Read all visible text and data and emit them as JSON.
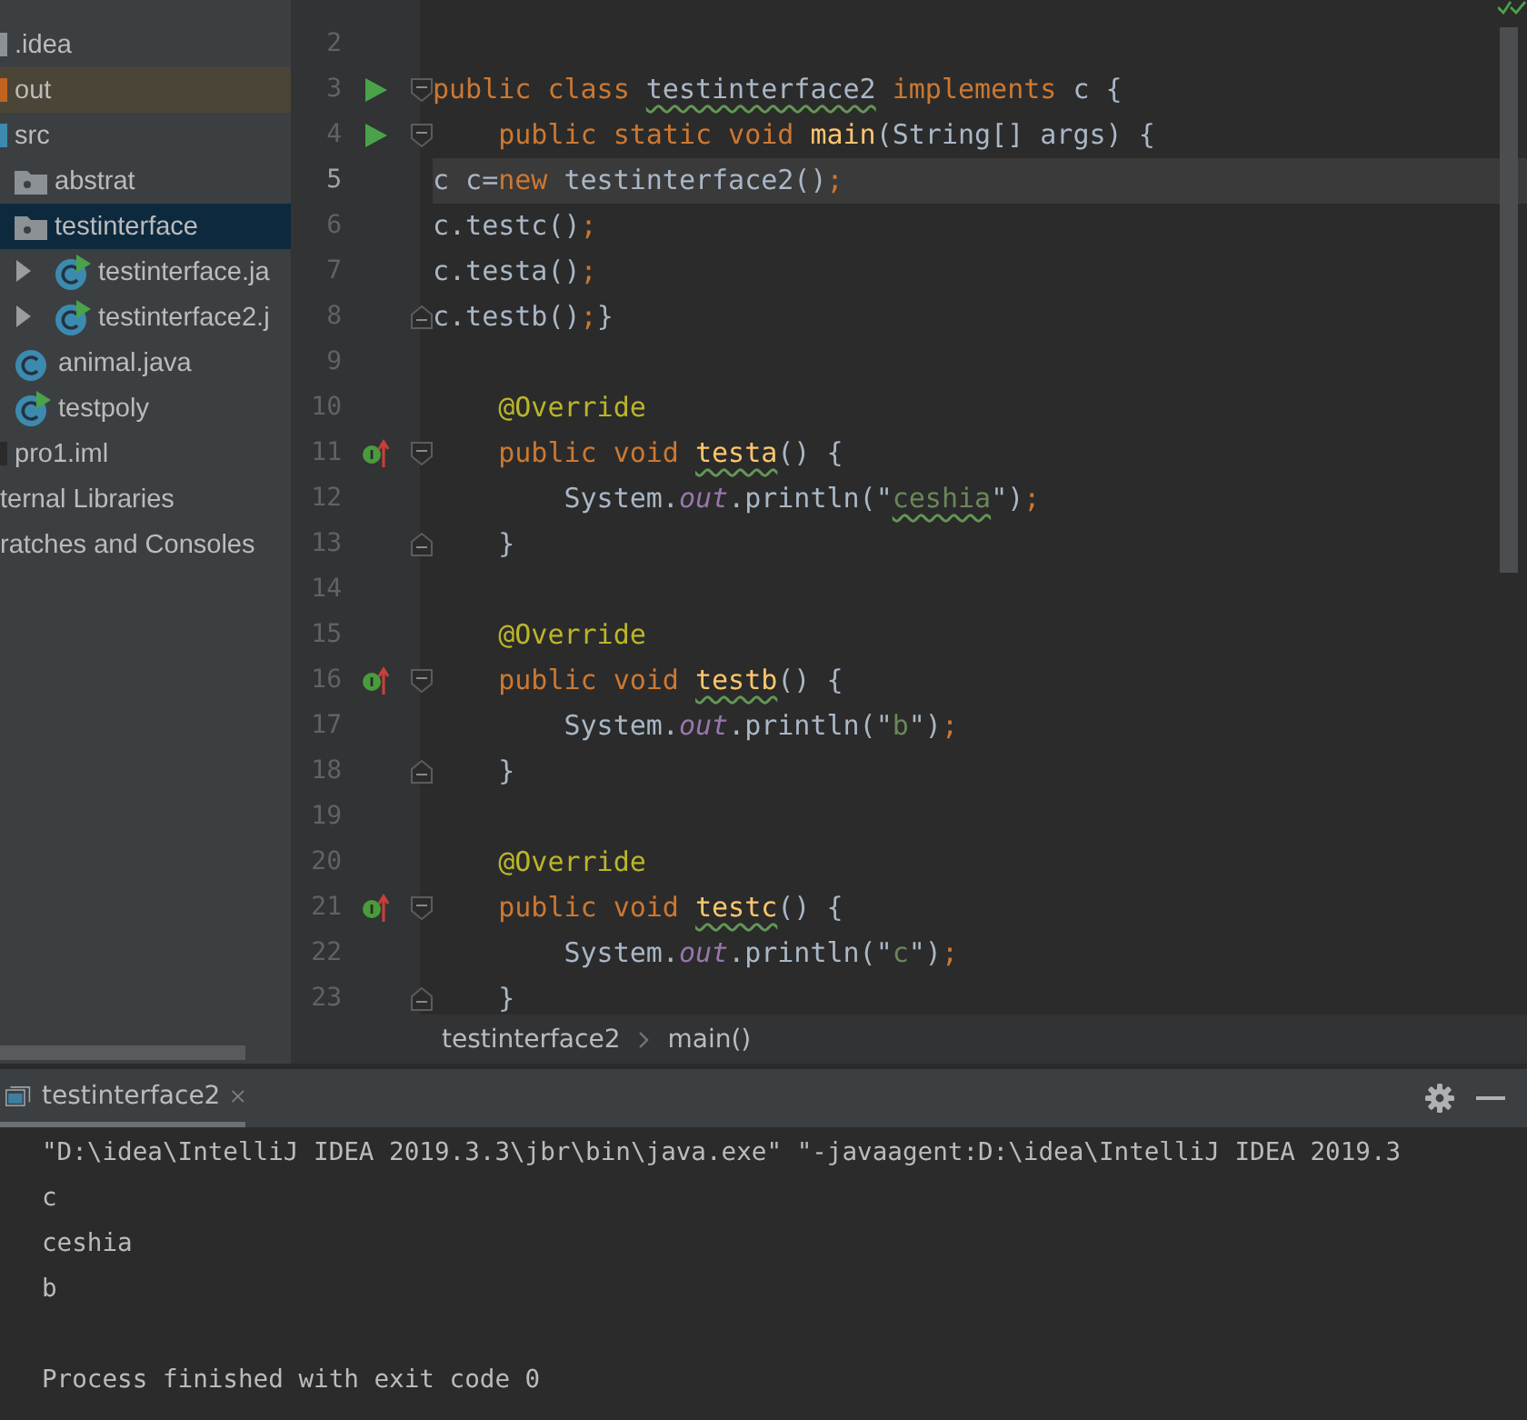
{
  "project_tree": {
    "items": [
      {
        "label": ".idea",
        "kind": "folder",
        "selected": false,
        "excluded": false
      },
      {
        "label": "out",
        "kind": "excluded-folder",
        "selected": false,
        "excluded": true
      },
      {
        "label": "src",
        "kind": "source-folder",
        "selected": false,
        "excluded": false,
        "children": [
          {
            "label": "abstrat",
            "kind": "package",
            "selected": false,
            "excluded": false
          },
          {
            "label": "testinterface",
            "kind": "package",
            "selected": true,
            "excluded": false,
            "children": [
              {
                "label": "testinterface.ja",
                "kind": "runnable-class",
                "selected": false,
                "excluded": false,
                "expanded": false
              },
              {
                "label": "testinterface2.j",
                "kind": "runnable-class",
                "selected": false,
                "excluded": false,
                "expanded": false
              }
            ]
          },
          {
            "label": "animal.java",
            "kind": "class",
            "selected": false,
            "excluded": false
          },
          {
            "label": "testpoly",
            "kind": "runnable-class",
            "selected": false,
            "excluded": false
          }
        ]
      },
      {
        "label": "pro1.iml",
        "kind": "file",
        "selected": false,
        "excluded": false
      },
      {
        "label": "ternal Libraries",
        "kind": "library",
        "selected": false,
        "excluded": false
      },
      {
        "label": "ratches and Consoles",
        "kind": "library",
        "selected": false,
        "excluded": false
      }
    ]
  },
  "editor": {
    "lines": [
      {
        "number": "2",
        "current": false,
        "run": false,
        "implements": false,
        "fold_start": false,
        "fold_end": false
      },
      {
        "number": "3",
        "current": false,
        "run": true,
        "implements": false,
        "fold_start": true,
        "fold_end": false,
        "tokens": [
          {
            "text": "public class ",
            "kind": "keyword"
          },
          {
            "text": "testinterface2",
            "kind": "plain",
            "underlined": true
          },
          {
            "text": " implements ",
            "kind": "keyword"
          },
          {
            "text": "c {",
            "kind": "plain"
          }
        ]
      },
      {
        "number": "4",
        "current": false,
        "run": true,
        "implements": false,
        "fold_start": true,
        "fold_end": false,
        "tokens": [
          {
            "text": "    public static void ",
            "kind": "keyword"
          },
          {
            "text": "main",
            "kind": "method"
          },
          {
            "text": "(String[] args) {",
            "kind": "plain"
          }
        ]
      },
      {
        "number": "5",
        "current": true,
        "run": false,
        "implements": false,
        "fold_start": false,
        "fold_end": false,
        "tokens": [
          {
            "text": "c c=",
            "kind": "plain"
          },
          {
            "text": "new",
            "kind": "keyword"
          },
          {
            "text": " testinterface2()",
            "kind": "plain"
          },
          {
            "text": ";",
            "kind": "keyword"
          }
        ]
      },
      {
        "number": "6",
        "current": false,
        "run": false,
        "implements": false,
        "fold_start": false,
        "fold_end": false,
        "tokens": [
          {
            "text": "c.testc()",
            "kind": "plain"
          },
          {
            "text": ";",
            "kind": "keyword"
          }
        ]
      },
      {
        "number": "7",
        "current": false,
        "run": false,
        "implements": false,
        "fold_start": false,
        "fold_end": false,
        "tokens": [
          {
            "text": "c.testa()",
            "kind": "plain"
          },
          {
            "text": ";",
            "kind": "keyword"
          }
        ]
      },
      {
        "number": "8",
        "current": false,
        "run": false,
        "implements": false,
        "fold_start": false,
        "fold_end": true,
        "tokens": [
          {
            "text": "c.testb()",
            "kind": "plain"
          },
          {
            "text": ";",
            "kind": "keyword"
          },
          {
            "text": "}",
            "kind": "plain"
          }
        ]
      },
      {
        "number": "9",
        "current": false,
        "run": false,
        "implements": false,
        "fold_start": false,
        "fold_end": false
      },
      {
        "number": "10",
        "current": false,
        "run": false,
        "implements": false,
        "fold_start": false,
        "fold_end": false,
        "tokens": [
          {
            "text": "    @Override",
            "kind": "annotation"
          }
        ]
      },
      {
        "number": "11",
        "current": false,
        "run": false,
        "implements": true,
        "fold_start": true,
        "fold_end": false,
        "tokens": [
          {
            "text": "    public void ",
            "kind": "keyword"
          },
          {
            "text": "testa",
            "kind": "method",
            "underlined": true
          },
          {
            "text": "() {",
            "kind": "plain"
          }
        ]
      },
      {
        "number": "12",
        "current": false,
        "run": false,
        "implements": false,
        "fold_start": false,
        "fold_end": false,
        "tokens": [
          {
            "text": "        System.",
            "kind": "plain"
          },
          {
            "text": "out",
            "kind": "field"
          },
          {
            "text": ".println(\"",
            "kind": "plain"
          },
          {
            "text": "ceshia",
            "kind": "string",
            "underlined": true
          },
          {
            "text": "\")",
            "kind": "plain"
          },
          {
            "text": ";",
            "kind": "keyword"
          }
        ]
      },
      {
        "number": "13",
        "current": false,
        "run": false,
        "implements": false,
        "fold_start": false,
        "fold_end": true,
        "tokens": [
          {
            "text": "    }",
            "kind": "plain"
          }
        ]
      },
      {
        "number": "14",
        "current": false,
        "run": false,
        "implements": false,
        "fold_start": false,
        "fold_end": false
      },
      {
        "number": "15",
        "current": false,
        "run": false,
        "implements": false,
        "fold_start": false,
        "fold_end": false,
        "tokens": [
          {
            "text": "    @Override",
            "kind": "annotation"
          }
        ]
      },
      {
        "number": "16",
        "current": false,
        "run": false,
        "implements": true,
        "fold_start": true,
        "fold_end": false,
        "tokens": [
          {
            "text": "    public void ",
            "kind": "keyword"
          },
          {
            "text": "testb",
            "kind": "method",
            "underlined": true
          },
          {
            "text": "() {",
            "kind": "plain"
          }
        ]
      },
      {
        "number": "17",
        "current": false,
        "run": false,
        "implements": false,
        "fold_start": false,
        "fold_end": false,
        "tokens": [
          {
            "text": "        System.",
            "kind": "plain"
          },
          {
            "text": "out",
            "kind": "field"
          },
          {
            "text": ".println(\"",
            "kind": "plain"
          },
          {
            "text": "b",
            "kind": "string"
          },
          {
            "text": "\")",
            "kind": "plain"
          },
          {
            "text": ";",
            "kind": "keyword"
          }
        ]
      },
      {
        "number": "18",
        "current": false,
        "run": false,
        "implements": false,
        "fold_start": false,
        "fold_end": true,
        "tokens": [
          {
            "text": "    }",
            "kind": "plain"
          }
        ]
      },
      {
        "number": "19",
        "current": false,
        "run": false,
        "implements": false,
        "fold_start": false,
        "fold_end": false
      },
      {
        "number": "20",
        "current": false,
        "run": false,
        "implements": false,
        "fold_start": false,
        "fold_end": false,
        "tokens": [
          {
            "text": "    @Override",
            "kind": "annotation"
          }
        ]
      },
      {
        "number": "21",
        "current": false,
        "run": false,
        "implements": true,
        "fold_start": true,
        "fold_end": false,
        "tokens": [
          {
            "text": "    public void ",
            "kind": "keyword"
          },
          {
            "text": "testc",
            "kind": "method",
            "underlined": true
          },
          {
            "text": "() {",
            "kind": "plain"
          }
        ]
      },
      {
        "number": "22",
        "current": false,
        "run": false,
        "implements": false,
        "fold_start": false,
        "fold_end": false,
        "tokens": [
          {
            "text": "        System.",
            "kind": "plain"
          },
          {
            "text": "out",
            "kind": "field"
          },
          {
            "text": ".println(\"",
            "kind": "plain"
          },
          {
            "text": "c",
            "kind": "string"
          },
          {
            "text": "\")",
            "kind": "plain"
          },
          {
            "text": ";",
            "kind": "keyword"
          }
        ]
      },
      {
        "number": "23",
        "current": false,
        "run": false,
        "implements": false,
        "fold_start": false,
        "fold_end": true,
        "tokens": [
          {
            "text": "    }",
            "kind": "plain"
          }
        ]
      }
    ],
    "breadcrumbs": [
      "testinterface2",
      "main()"
    ]
  },
  "run_panel": {
    "tab": "testinterface2",
    "output": [
      "\"D:\\idea\\IntelliJ IDEA 2019.3.3\\jbr\\bin\\java.exe\" \"-javaagent:D:\\idea\\IntelliJ IDEA 2019.3",
      "c",
      "ceshia",
      "b"
    ],
    "exit_message": "Process finished with exit code 0"
  }
}
